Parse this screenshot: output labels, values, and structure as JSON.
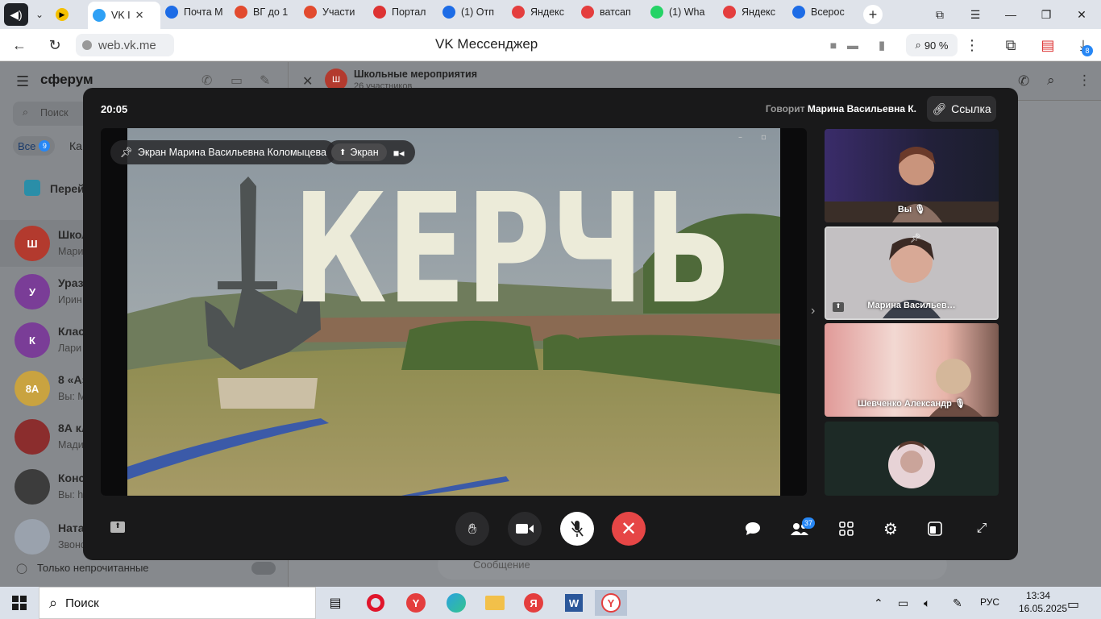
{
  "browser": {
    "tabs": [
      {
        "label": "VK I",
        "icon": "vk-icon",
        "color": "#2ea0f5",
        "active": true
      },
      {
        "label": "Почта М",
        "icon": "mail-icon",
        "color": "#1d6ce6"
      },
      {
        "label": "ВГ до 1",
        "icon": "doc-icon",
        "color": "#e24a2e"
      },
      {
        "label": "Участи",
        "icon": "doc-icon",
        "color": "#e24a2e"
      },
      {
        "label": "Портал",
        "icon": "flag-icon",
        "color": "#d33"
      },
      {
        "label": "(1) Отп",
        "icon": "mail-icon",
        "color": "#1d6ce6"
      },
      {
        "label": "Яндекс",
        "icon": "yandex-icon",
        "color": "#e43e3e"
      },
      {
        "label": "ватсап",
        "icon": "yandex-icon",
        "color": "#e43e3e"
      },
      {
        "label": "(1) Wha",
        "icon": "whatsapp-icon",
        "color": "#25d366"
      },
      {
        "label": "Яндекс",
        "icon": "yandex-icon",
        "color": "#e43e3e"
      },
      {
        "label": "Всерос",
        "icon": "cloud-icon",
        "color": "#1d6ce6"
      }
    ],
    "url": "web.vk.me",
    "page_title": "VK Мессенджер",
    "zoom": "90 %",
    "downloads_count": "8"
  },
  "sidebar": {
    "brand": "сферум",
    "search_placeholder": "Поиск",
    "filter_all": "Все",
    "filter_all_count": "9",
    "filter_next": "Ка",
    "folder": "Перей",
    "chats": [
      {
        "title": "Школ",
        "sub": "Мари",
        "avatar": "Ш",
        "color": "#b33a2e"
      },
      {
        "title": "Ураз",
        "sub": "Ирин",
        "avatar": "У",
        "color": "#7a3d97"
      },
      {
        "title": "Клас",
        "sub": "Лари",
        "avatar": "К",
        "color": "#7a3d97"
      },
      {
        "title": "8 «А»",
        "sub": "Вы: М",
        "avatar": "8А",
        "color": "#c9a340"
      },
      {
        "title": "8А кл",
        "sub": "Мади",
        "avatar": "",
        "color": "#8b2d2d"
      },
      {
        "title": "Конс",
        "sub": "Вы: h",
        "avatar": "",
        "color": "#3c3c3c"
      },
      {
        "title": "Ната",
        "sub": "Звонс",
        "avatar": "",
        "color": "#9aa2ad"
      }
    ],
    "only_unread": "Только непрочитанные"
  },
  "chat_header": {
    "avatar_letter": "Ш",
    "title": "Школьные мероприятия",
    "sub": "26 участников"
  },
  "composer_placeholder": "Сообщение",
  "call": {
    "time": "20:05",
    "speaking_prefix": "Говорит",
    "speaking_name": "Марина Васильевна К.",
    "link_label": "Ссылка",
    "screen_owner": "Экран Марина Васильевна Коломыцева",
    "screen_tab": "Экран",
    "sign_text": "КЕРЧЬ",
    "participants": [
      {
        "name": "Вы",
        "muted": true
      },
      {
        "name": "Марина Васильев…",
        "muted": false
      },
      {
        "name": "Шевченко Александр",
        "muted": true
      },
      {
        "name": "",
        "muted": false
      }
    ],
    "participants_count": "37"
  },
  "taskbar": {
    "search_label": "Поиск",
    "lang": "РУС",
    "time": "13:34",
    "date": "16.05.2025"
  }
}
